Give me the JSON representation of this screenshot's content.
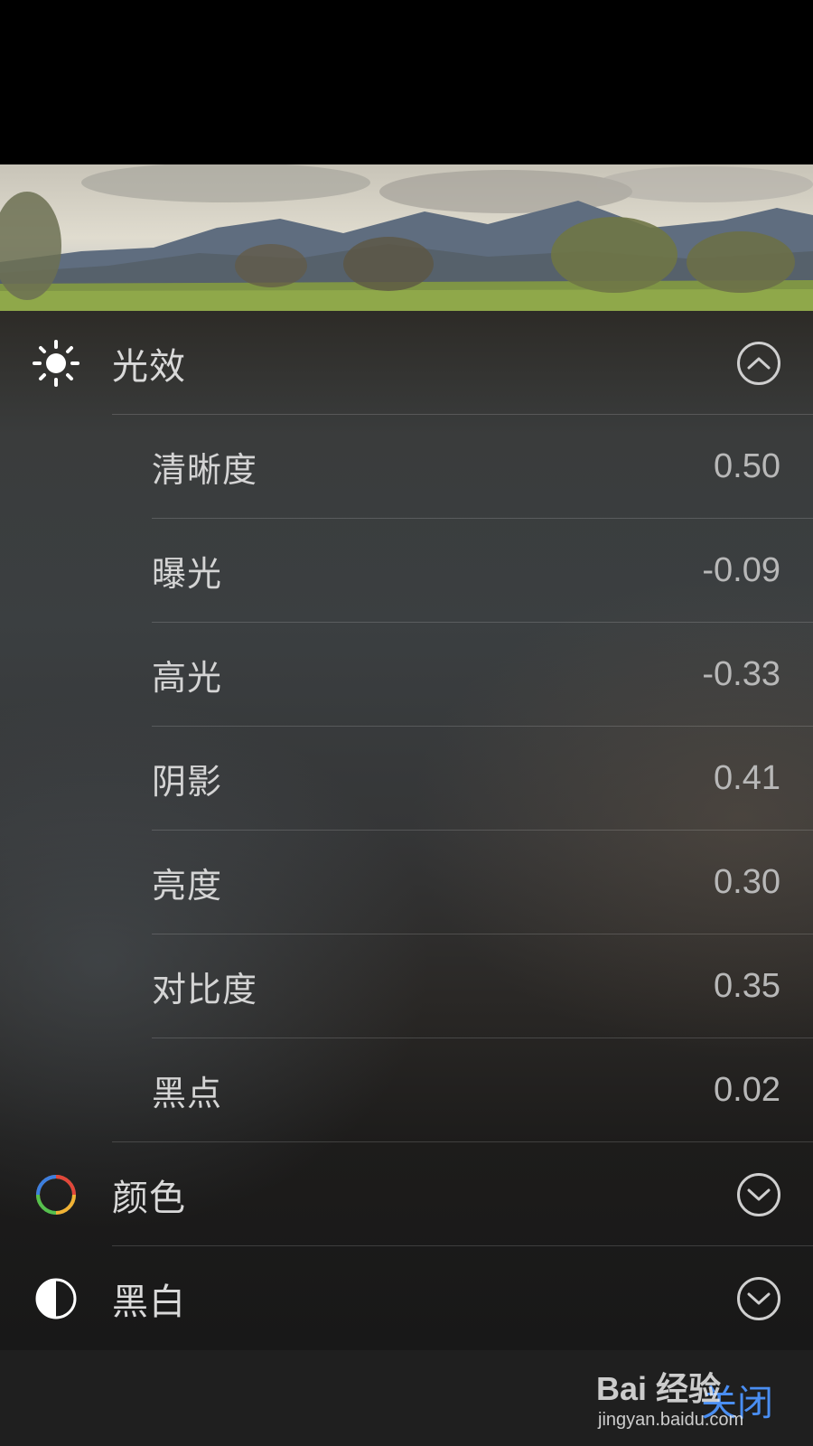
{
  "sections": [
    {
      "label": "光效",
      "icon": "sun-icon",
      "expanded": true,
      "items": [
        {
          "label": "清晰度",
          "value": "0.50"
        },
        {
          "label": "曝光",
          "value": "-0.09"
        },
        {
          "label": "高光",
          "value": "-0.33"
        },
        {
          "label": "阴影",
          "value": "0.41"
        },
        {
          "label": "亮度",
          "value": "0.30"
        },
        {
          "label": "对比度",
          "value": "0.35"
        },
        {
          "label": "黑点",
          "value": "0.02"
        }
      ]
    },
    {
      "label": "颜色",
      "icon": "color-wheel-icon",
      "expanded": false
    },
    {
      "label": "黑白",
      "icon": "half-circle-icon",
      "expanded": false
    }
  ],
  "footer": {
    "close_label": "关闭"
  },
  "watermark": {
    "logo": "Bai 经验",
    "url": "jingyan.baidu.com"
  },
  "colors": {
    "accent": "#4a8ef2",
    "label": "#d4d4d4",
    "value": "#b8b8b8"
  }
}
